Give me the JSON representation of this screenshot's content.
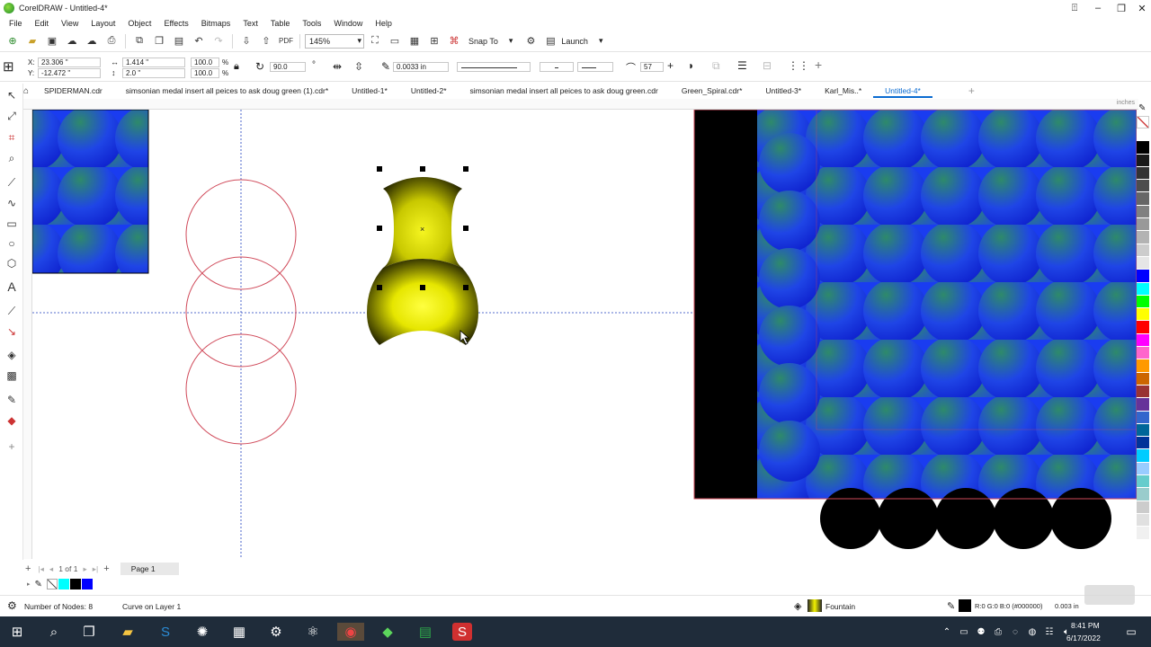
{
  "window": {
    "title": "CorelDRAW - Untitled-4*"
  },
  "menu": [
    "File",
    "Edit",
    "View",
    "Layout",
    "Object",
    "Effects",
    "Bitmaps",
    "Text",
    "Table",
    "Tools",
    "Window",
    "Help"
  ],
  "toolbar": {
    "zoom": "145%",
    "snap_to": "Snap To",
    "launch": "Launch"
  },
  "property_bar": {
    "x": "23.306 \"",
    "y": "-12.472 \"",
    "width": "1.414 \"",
    "height": "2.0 \"",
    "scale_x": "100.0",
    "scale_y": "100.0",
    "pct1": "%",
    "pct2": "%",
    "rotation": "90.0",
    "degree": "°",
    "outline_width": "0.0033 in",
    "nib": "57"
  },
  "tabs": [
    {
      "label": "SPIDERMAN.cdr",
      "active": false
    },
    {
      "label": "simsonian medal insert all peices to ask doug green (1).cdr*",
      "active": false
    },
    {
      "label": "Untitled-1*",
      "active": false
    },
    {
      "label": "Untitled-2*",
      "active": false
    },
    {
      "label": "simsonian medal insert all peices to ask doug green.cdr",
      "active": false
    },
    {
      "label": "Green_Spiral.cdr*",
      "active": false
    },
    {
      "label": "Untitled-3*",
      "active": false
    },
    {
      "label": "Karl_Mis..*",
      "active": false
    },
    {
      "label": "Untitled-4*",
      "active": true
    }
  ],
  "ruler": {
    "unit": "inches"
  },
  "page_nav": {
    "counter": "1 of 1",
    "page_tab": "Page 1"
  },
  "status": {
    "nodes": "Number of Nodes: 8",
    "layer": "Curve on Layer 1",
    "fill_type": "Fountain",
    "outline_color": "R:0 G:0 B:0 (#000000)",
    "outline_width": "0.003 in"
  },
  "taskbar": {
    "time": "8:41 PM",
    "date": "6/17/2022"
  },
  "colors": {
    "accent": "#0a6bd1",
    "guide": "#1f3fbf",
    "circle_stroke": "#d04a5a",
    "fill_yellow": "#f2f200",
    "fill_blue": "#1a3cf0",
    "fill_teal": "#2e8a6a"
  },
  "palette": [
    "#ffffff",
    "#000000",
    "#1a1a1a",
    "#333333",
    "#4d4d4d",
    "#666666",
    "#808080",
    "#999999",
    "#b3b3b3",
    "#cccccc",
    "#e6e6e6",
    "#0000ff",
    "#00ffff",
    "#00ff00",
    "#ffff00",
    "#ff0000",
    "#ff00ff",
    "#ff66cc",
    "#ff9900",
    "#cc6600",
    "#993333",
    "#663399",
    "#3366cc",
    "#006699",
    "#003399",
    "#00ccff",
    "#99ccff",
    "#66cccc",
    "#99cccc",
    "#cccccc",
    "#e0e0e0",
    "#f0f0f0"
  ],
  "icons": [
    "new-doc-icon",
    "open-icon",
    "save-icon",
    "undo-icon",
    "redo-icon",
    "import-icon",
    "export-icon",
    "pdf-icon",
    "zoom-fit-icon",
    "settings-icon",
    "pick-tool-icon",
    "shape-tool-icon",
    "crop-tool-icon",
    "zoom-tool-icon",
    "freehand-tool-icon",
    "rectangle-tool-icon",
    "ellipse-tool-icon",
    "polygon-tool-icon",
    "text-tool-icon",
    "connector-tool-icon",
    "drop-shadow-tool-icon",
    "transparency-tool-icon",
    "eyedropper-tool-icon",
    "fill-tool-icon"
  ]
}
